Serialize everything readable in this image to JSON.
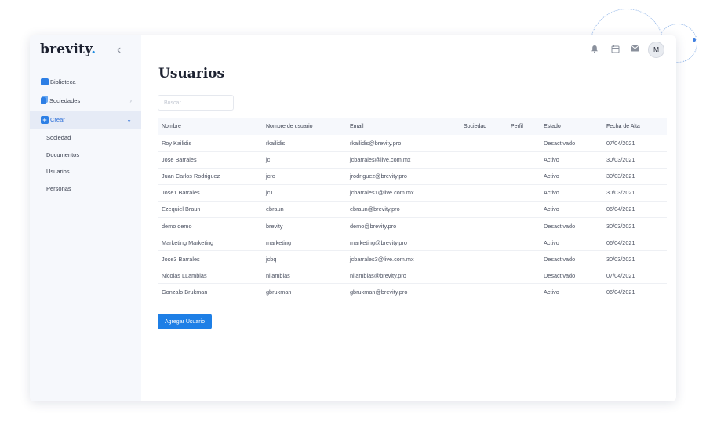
{
  "app": {
    "logo_text": "brevity",
    "logo_dot": "."
  },
  "sidebar": {
    "items": [
      {
        "label": "Biblioteca",
        "icon": "folder-icon"
      },
      {
        "label": "Sociedades",
        "icon": "books-icon"
      },
      {
        "label": "Crear",
        "icon": "plus-icon"
      }
    ],
    "subitems": [
      "Sociedad",
      "Documentos",
      "Usuarios",
      "Personas"
    ]
  },
  "topbar": {
    "avatar_initial": "M",
    "icons": [
      "bell-icon",
      "calendar-icon",
      "mail-icon"
    ]
  },
  "main": {
    "title": "Usuarios",
    "search_placeholder": "Buscar",
    "add_button": "Agregar Usuario"
  },
  "table": {
    "headers": [
      "Nombre",
      "Nombre de usuario",
      "Email",
      "Sociedad",
      "Perfil",
      "Estado",
      "Fecha de Alta"
    ],
    "rows": [
      [
        "Roy Kailidis",
        "rkailidis",
        "rkailidis@brevity.pro",
        "",
        "",
        "Desactivado",
        "07/04/2021"
      ],
      [
        "Jose Barrales",
        "jc",
        "jcbarrales@live.com.mx",
        "",
        "",
        "Activo",
        "30/03/2021"
      ],
      [
        "Juan Carlos Rodriguez",
        "jcrc",
        "jrodriguez@brevity.pro",
        "",
        "",
        "Activo",
        "30/03/2021"
      ],
      [
        "Jose1 Barrales",
        "jc1",
        "jcbarrales1@live.com.mx",
        "",
        "",
        "Activo",
        "30/03/2021"
      ],
      [
        "Ezequiel Braun",
        "ebraun",
        "ebraun@brevity.pro",
        "",
        "",
        "Activo",
        "06/04/2021"
      ],
      [
        "demo demo",
        "brevity",
        "demo@brevity.pro",
        "",
        "",
        "Desactivado",
        "30/03/2021"
      ],
      [
        "Marketing Marketing",
        "marketing",
        "marketing@brevity.pro",
        "",
        "",
        "Activo",
        "06/04/2021"
      ],
      [
        "Jose3 Barrales",
        "jcbq",
        "jcbarrales3@live.com.mx",
        "",
        "",
        "Desactivado",
        "30/03/2021"
      ],
      [
        "Nicolas LLambias",
        "nllambias",
        "nllambias@brevity.pro",
        "",
        "",
        "Desactivado",
        "07/04/2021"
      ],
      [
        "Gonzalo Brukman",
        "gbrukman",
        "gbrukman@brevity.pro",
        "",
        "",
        "Activo",
        "06/04/2021"
      ]
    ]
  },
  "colors": {
    "accent": "#1e7fe6",
    "sidebar_bg": "#f6f8fc",
    "active_bg": "#e6ebf6"
  }
}
